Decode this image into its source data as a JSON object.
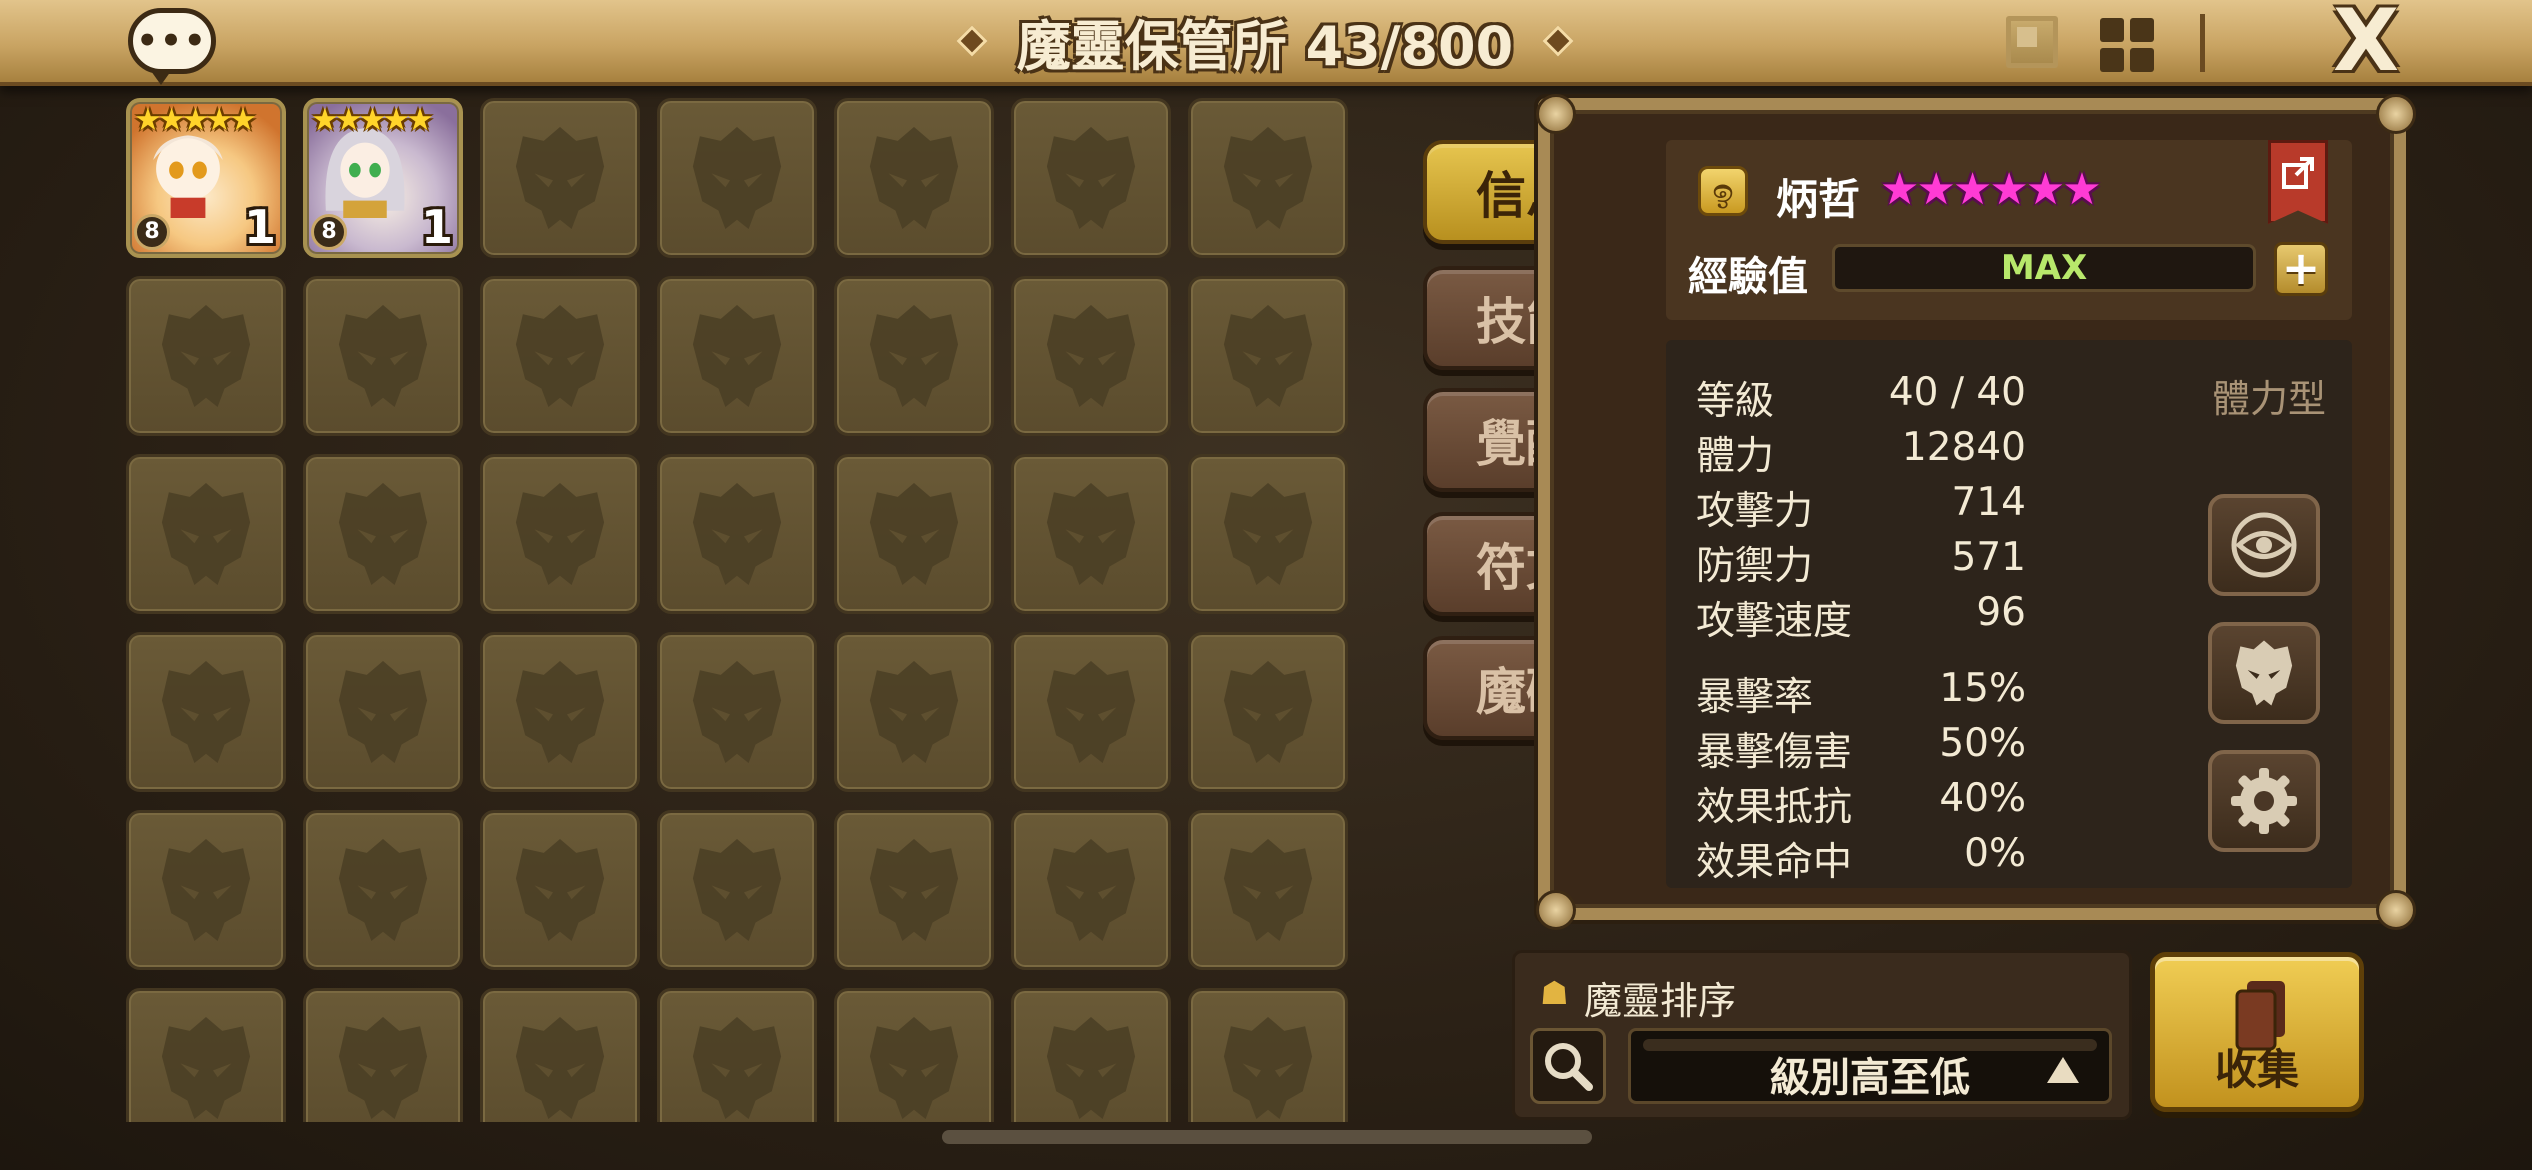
{
  "title": "魔靈保管所 43/800",
  "chat_icon": "chat-bubble-icon",
  "close_label": "X",
  "grid": {
    "rows": 6,
    "cols": 7,
    "monsters": [
      {
        "stars": "★★★★★",
        "level_badge": "8",
        "count": "1",
        "theme": "fire-girl"
      },
      {
        "stars": "★★★★★",
        "level_badge": "8",
        "count": "1",
        "theme": "wind-girl"
      }
    ]
  },
  "tabs": [
    "信息",
    "技能",
    "覺醒",
    "符文",
    "魔礦"
  ],
  "monster": {
    "name": "炳哲",
    "stars": "★★★★★★",
    "exp_label": "經驗值",
    "exp_value": "MAX",
    "plus": "+",
    "type": "體力型",
    "stats": [
      {
        "name": "等級",
        "value": "40 / 40"
      },
      {
        "name": "體力",
        "value": "12840"
      },
      {
        "name": "攻擊力",
        "value": "714"
      },
      {
        "name": "防禦力",
        "value": "571"
      },
      {
        "name": "攻擊速度",
        "value": "96"
      },
      {
        "name": "暴擊率",
        "value": "15%"
      },
      {
        "name": "暴擊傷害",
        "value": "50%"
      },
      {
        "name": "效果抵抗",
        "value": "40%"
      },
      {
        "name": "效果命中",
        "value": "0%"
      }
    ]
  },
  "sort": {
    "title": "魔靈排序",
    "selected": "級別高至低"
  },
  "collect_label": "收集",
  "colors": {
    "accent_gold": "#e2b441",
    "pink_star": "#ff3bd5",
    "exp_green": "#b8e86b"
  }
}
